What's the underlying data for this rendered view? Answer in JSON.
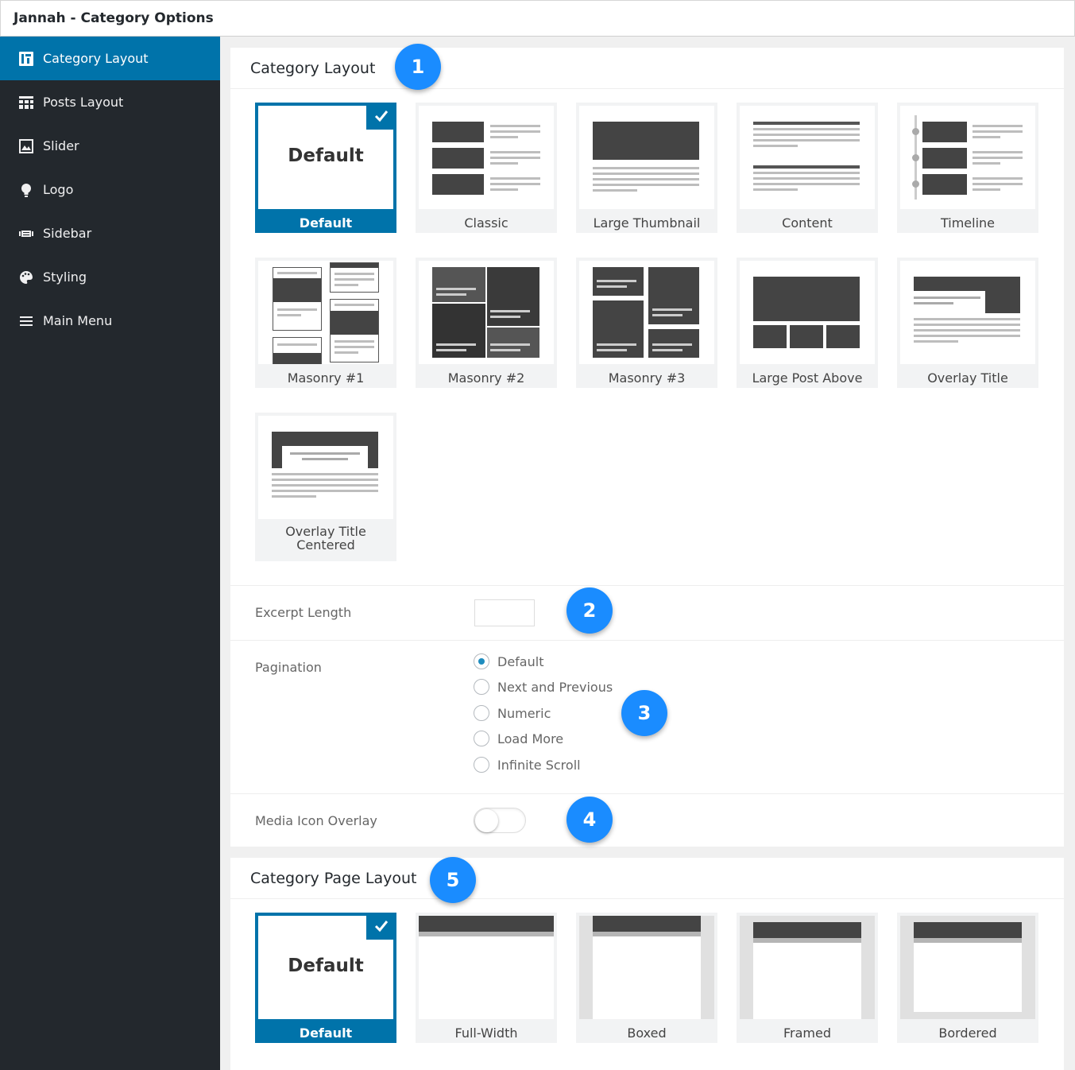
{
  "window": {
    "title": "Jannah - Category Options"
  },
  "sidebar": {
    "items": [
      {
        "label": "Category Layout",
        "icon": "layout-icon",
        "active": true
      },
      {
        "label": "Posts Layout",
        "icon": "grid-icon",
        "active": false
      },
      {
        "label": "Slider",
        "icon": "slider-icon",
        "active": false
      },
      {
        "label": "Logo",
        "icon": "lightbulb-icon",
        "active": false
      },
      {
        "label": "Sidebar",
        "icon": "sidebar-icon",
        "active": false
      },
      {
        "label": "Styling",
        "icon": "palette-icon",
        "active": false
      },
      {
        "label": "Main Menu",
        "icon": "menu-icon",
        "active": false
      }
    ]
  },
  "category_layout": {
    "heading": "Category Layout",
    "badge": "1",
    "default_text": "Default",
    "options": [
      "Default",
      "Classic",
      "Large Thumbnail",
      "Content",
      "Timeline",
      "Masonry #1",
      "Masonry #2",
      "Masonry #3",
      "Large Post Above",
      "Overlay Title",
      "Overlay Title Centered"
    ],
    "selected": "Default"
  },
  "excerpt": {
    "label": "Excerpt Length",
    "value": "",
    "badge": "2"
  },
  "pagination": {
    "label": "Pagination",
    "badge": "3",
    "options": [
      "Default",
      "Next and Previous",
      "Numeric",
      "Load More",
      "Infinite Scroll"
    ],
    "selected": "Default"
  },
  "media_icon": {
    "label": "Media Icon Overlay",
    "enabled": false,
    "badge": "4"
  },
  "page_layout": {
    "heading": "Category Page Layout",
    "badge": "5",
    "default_text": "Default",
    "options": [
      "Default",
      "Full-Width",
      "Boxed",
      "Framed",
      "Bordered"
    ],
    "selected": "Default"
  },
  "colors": {
    "accent": "#0073aa",
    "sidebar_bg": "#23282d",
    "badge": "#1a8cff"
  }
}
